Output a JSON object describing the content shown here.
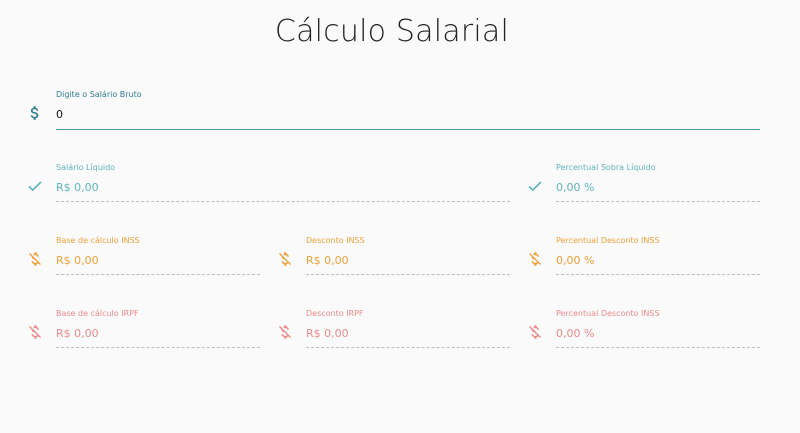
{
  "page": {
    "title": "Cálculo Salarial"
  },
  "gross_salary": {
    "label": "Digite o Salário Bruto",
    "value": "0",
    "icon": "dollar-icon",
    "color": "#2e7d8f"
  },
  "net": {
    "salary_label": "Salário Líquido",
    "salary_value": "R$ 0,00",
    "percent_label": "Percentual Sobra Líquido",
    "percent_value": "0,00 %",
    "icon": "check-icon",
    "color": "#62b3be"
  },
  "inss": {
    "base_label": "Base de cálculo INSS",
    "base_value": "R$ 0,00",
    "discount_label": "Desconto INSS",
    "discount_value": "R$ 0,00",
    "percent_label": "Percentual Desconto INSS",
    "percent_value": "0,00 %",
    "icon": "money-off-icon",
    "color": "#f0a03a"
  },
  "irpf": {
    "base_label": "Base de cálculo IRPF",
    "base_value": "R$ 0,00",
    "discount_label": "Desconto IRPF",
    "discount_value": "R$ 0,00",
    "percent_label": "Percentual Desconto INSS",
    "percent_value": "0,00 %",
    "icon": "money-off-icon",
    "color": "#ef8a8a"
  }
}
